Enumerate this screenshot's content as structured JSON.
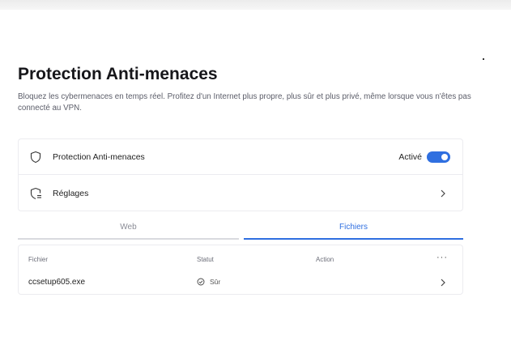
{
  "page": {
    "title": "Protection Anti-menaces",
    "description": "Bloquez les cybermenaces en temps réel. Profitez d'un Internet plus propre, plus sûr et plus privé, même lorsque vous n'êtes pas connecté au VPN."
  },
  "settings": {
    "protection_label": "Protection Anti-menaces",
    "protection_status": "Activé",
    "toggle_on": true,
    "settings_label": "Réglages"
  },
  "tabs": {
    "web": "Web",
    "files": "Fichiers",
    "active": "Fichiers"
  },
  "table": {
    "headers": {
      "file": "Fichier",
      "status": "Statut",
      "action": "Action",
      "more": "···"
    },
    "rows": [
      {
        "file": "ccsetup605.exe",
        "status": "Sûr"
      }
    ]
  },
  "colors": {
    "accent": "#2f6fe0",
    "text": "#1f1f24",
    "muted": "#5b5d69",
    "border": "#ececf0"
  }
}
